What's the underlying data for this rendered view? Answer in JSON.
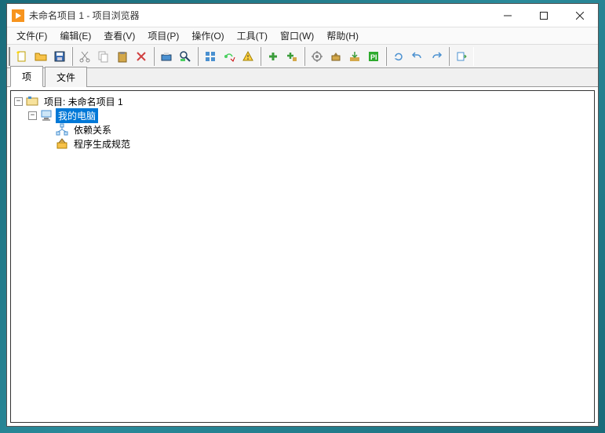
{
  "window": {
    "title": "未命名项目 1 - 项目浏览器"
  },
  "menubar": {
    "items": [
      {
        "label": "文件(F)"
      },
      {
        "label": "编辑(E)"
      },
      {
        "label": "查看(V)"
      },
      {
        "label": "项目(P)"
      },
      {
        "label": "操作(O)"
      },
      {
        "label": "工具(T)"
      },
      {
        "label": "窗口(W)"
      },
      {
        "label": "帮助(H)"
      }
    ]
  },
  "tabs": {
    "active": 0,
    "items": [
      {
        "label": "项"
      },
      {
        "label": "文件"
      }
    ]
  },
  "tree": {
    "root": {
      "label": "项目: 未命名项目 1",
      "children": [
        {
          "label": "我的电脑",
          "selected": true,
          "children": [
            {
              "label": "依赖关系"
            },
            {
              "label": "程序生成规范"
            }
          ]
        }
      ]
    }
  },
  "colors": {
    "selection": "#0078d7",
    "accent": "#f7941e"
  }
}
